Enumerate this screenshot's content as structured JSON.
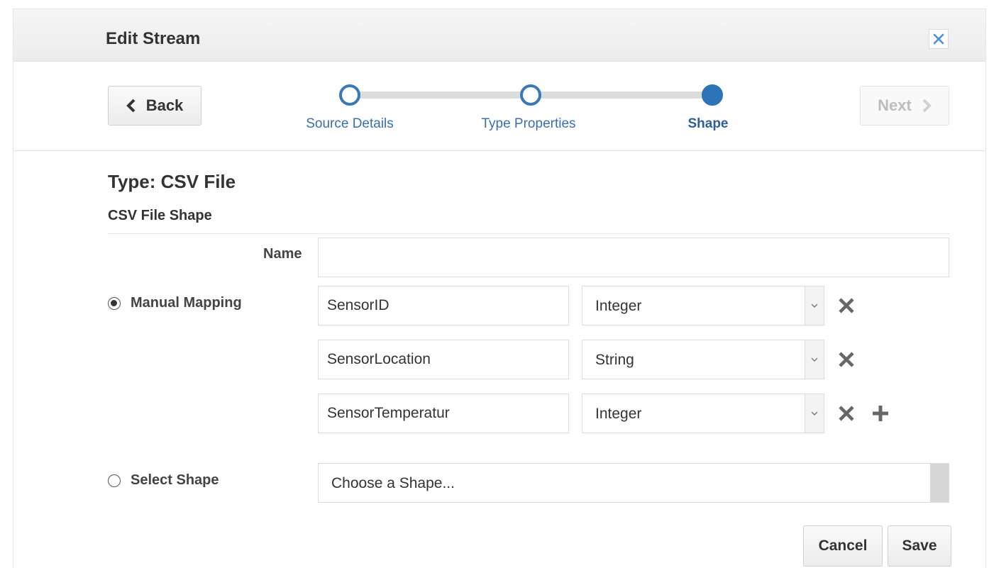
{
  "dialog": {
    "title": "Edit Stream",
    "close_icon": "close-icon"
  },
  "wizard": {
    "back_label": "Back",
    "next_label": "Next",
    "steps": [
      {
        "label": "Source Details",
        "state": "visited"
      },
      {
        "label": "Type Properties",
        "state": "visited"
      },
      {
        "label": "Shape",
        "state": "current"
      }
    ]
  },
  "form": {
    "type_heading": "Type: CSV File",
    "section_heading": "CSV File Shape",
    "name_label": "Name",
    "name_value": "",
    "manual_mapping_label": "Manual Mapping",
    "manual_mapping_checked": true,
    "fields": [
      {
        "name": "SensorID",
        "type": "Integer"
      },
      {
        "name": "SensorLocation",
        "type": "String"
      },
      {
        "name": "SensorTemperatur",
        "type": "Integer"
      }
    ],
    "select_shape_label": "Select Shape",
    "select_shape_checked": false,
    "select_shape_placeholder": "Choose a Shape..."
  },
  "footer": {
    "cancel_label": "Cancel",
    "save_label": "Save"
  },
  "colors": {
    "accent": "#2d73b8",
    "link": "#3a6fab",
    "close": "#4a90d9"
  }
}
